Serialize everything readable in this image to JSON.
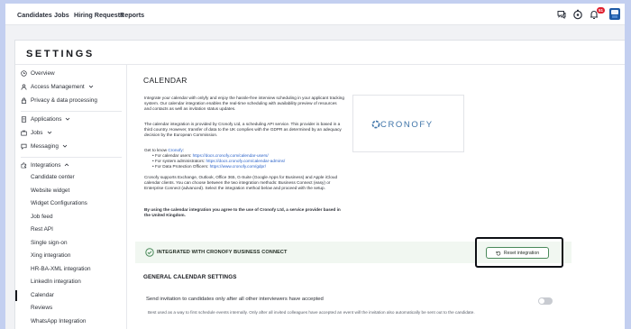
{
  "nav": {
    "links": [
      "Candidates",
      "Jobs",
      "Hiring Requests",
      "Reports"
    ],
    "icons": [
      "chat-icon",
      "timer-icon",
      "notification-icon",
      "avatar"
    ],
    "notification_count": "51"
  },
  "page": {
    "title": "SETTINGS"
  },
  "sidebar": {
    "top_items": [
      {
        "label": "Overview",
        "icon": "clock-icon"
      },
      {
        "label": "Access Management",
        "icon": "person-icon"
      },
      {
        "label": "Privacy & data processing",
        "icon": "lock-icon"
      }
    ],
    "groups": [
      {
        "label": "Applications",
        "icon": "document-icon"
      },
      {
        "label": "Jobs",
        "icon": "briefcase-icon"
      },
      {
        "label": "Messaging",
        "icon": "chat-icon"
      },
      {
        "label": "Integrations",
        "icon": "puzzle-icon"
      }
    ],
    "integration_items": [
      "Candidate center",
      "Website widget",
      "Widget Configurations",
      "Job feed",
      "Rest API",
      "Single sign-on",
      "Xing integration",
      "HR-BA-XML integration",
      "LinkedIn integration",
      "Calendar",
      "Reviews",
      "WhatsApp Integration"
    ],
    "active_item": "Calendar"
  },
  "main": {
    "section_title": "CALENDAR",
    "intro": "Integrate your calendar with onlyfy and enjoy the hassle-free interview scheduling in your applicant tracking system. Our calendar integration enables the real-time scheduling with availability preview of resources and contacts as well as invitation status updates.",
    "provider_text": "The calendar integration is provided by Cronofy Ltd, a scheduling API service. This provider is based in a third country. However, transfer of data to the UK complies with the GDPR as determined by an adequacy decision by the European Commission.",
    "get_to_know_prefix": "Get to know ",
    "get_to_know_link": "Cronofy",
    "get_to_know_suffix": ":",
    "bullets": [
      {
        "prefix": "For calendar users: ",
        "link": "https://docs.cronofy.com/calendar-users/"
      },
      {
        "prefix": "For system administrators: ",
        "link": "https://docs.cronofy.com/calendar-admins/"
      },
      {
        "prefix": "For Data Protection Officers: ",
        "link": "https://www.cronofy.com/gdpr/"
      }
    ],
    "support_text": "Cronofy supports Exchange, Outlook, Office 365, G-Suite (Google Apps for Business) and Apple iCloud calendar clients. You can choose between the two integration methods: Business Connect (easy) or Enterprise Connect (advanced). Select the integration method below and proceed with the setup.",
    "agreement_text": "By using the calendar integration you agree to the use of Cronofy Ltd, a service provider based in the United Kingdom.",
    "logo_text": "CRONOFY",
    "integration_status": "INTEGRATED WITH CRONOFY BUSINESS CONNECT",
    "reset_button": "Reset integration",
    "general_title": "GENERAL CALENDAR SETTINGS",
    "option_label": "Send invitation to candidates only after all other interviewers have accepted",
    "option_hint": "Best used as a way to first schedule events internally. Only after all invited colleagues have accepted an event will the invitation also automatically be sent out to the candidate.",
    "option_enabled": false
  },
  "colors": {
    "accent_green": "#4a8a5a",
    "link_blue": "#2a62c9",
    "badge_red": "#e0202f",
    "brand_blue": "#3f74a8"
  }
}
